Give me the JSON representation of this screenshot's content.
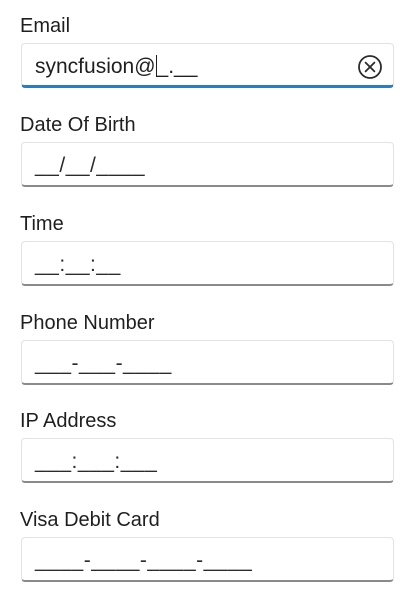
{
  "fields": [
    {
      "label": "Email",
      "value_before_caret": "syncfusion@",
      "value_after_caret": "_.__",
      "focused": true,
      "has_clear": true
    },
    {
      "label": "Date Of Birth",
      "value": "__/__/____"
    },
    {
      "label": "Time",
      "value": "__:__:__"
    },
    {
      "label": "Phone Number",
      "value": "___-___-____"
    },
    {
      "label": "IP Address",
      "value": "___:___:___"
    },
    {
      "label": "Visa Debit Card",
      "value": "____-____-____-____"
    }
  ],
  "icons": {
    "clear": "clear-circle-x-icon"
  },
  "colors": {
    "focus_underline": "#2a7bc8",
    "inactive_underline": "#8a8a8a",
    "border": "#e3e3e3"
  }
}
